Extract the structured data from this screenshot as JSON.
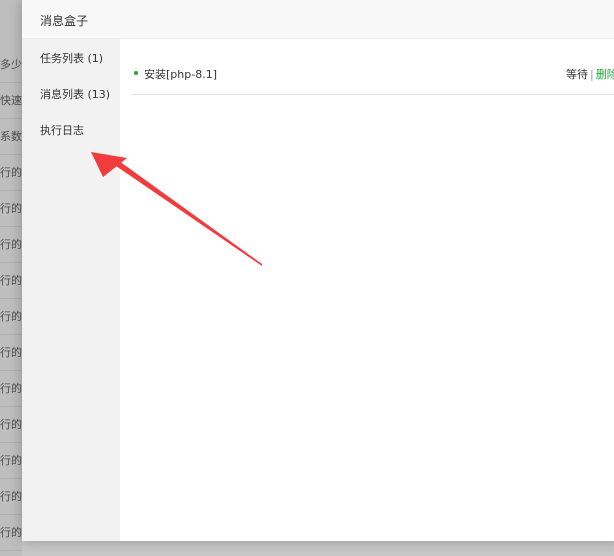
{
  "background_rows": [
    "多少，",
    "快速、",
    "系数:",
    "行的编",
    "行的编",
    "行的编",
    "行的编",
    "行的编",
    "行的编",
    "行的编",
    "行的编",
    "行的编",
    "行的编",
    "行的编"
  ],
  "modal": {
    "title": "消息盒子"
  },
  "sidebar": {
    "items": [
      {
        "label": "任务列表 (1)"
      },
      {
        "label": "消息列表 (13)"
      },
      {
        "label": "执行日志"
      }
    ]
  },
  "tasks": [
    {
      "name": "安装[php-8.1]",
      "status": "等待",
      "separator": "|",
      "action": "删除"
    }
  ],
  "colors": {
    "accent_green": "#20a53a",
    "annotation_arrow": "#f03c3c"
  },
  "annotation": {
    "icon": "red-arrow-icon"
  }
}
